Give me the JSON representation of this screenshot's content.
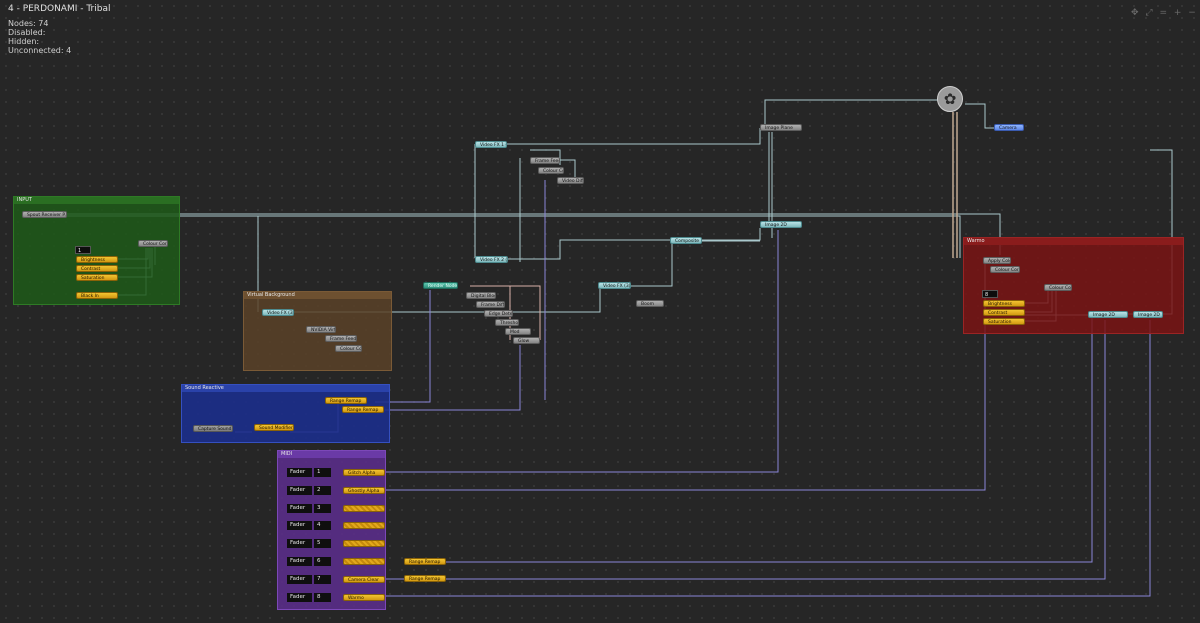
{
  "header": {
    "title": "4  -  PERDONAMI  -  Tribal",
    "stats": [
      {
        "label": "Nodes:",
        "value": "74"
      },
      {
        "label": "Disabled:",
        "value": ""
      },
      {
        "label": "Hidden:",
        "value": ""
      },
      {
        "label": "Unconnected:",
        "value": "4"
      }
    ]
  },
  "toolbar": {
    "icons": [
      "move-icon",
      "fit-icon",
      "equals-icon",
      "plus-icon",
      "minus-icon"
    ],
    "glyphs": "✥ ⤢ = + −"
  },
  "groups": {
    "input": {
      "title": "INPUT"
    },
    "virtual_background": {
      "title": "Virtual Background"
    },
    "sound_reactive": {
      "title": "Sound Reactive"
    },
    "midi": {
      "title": "MIDI"
    },
    "warmo": {
      "title": "Warmo"
    }
  },
  "input_group": {
    "value_box": "1",
    "source": "Spout Receiver P...",
    "colour_correct": "Colour Corr...",
    "params": [
      "Brightness",
      "Contrast",
      "Saturation",
      "Black In"
    ]
  },
  "top_chain": {
    "video_fx_1": "Video FX 1 (3)",
    "frame_feedback": "Frame Feedb...",
    "colour_corr": "Colour Corr...",
    "video_diff": "Video Diff...",
    "image_plane": "Image Plane",
    "camera": "Camera",
    "composite": "Composite 1...",
    "image_2d": "Image 2D"
  },
  "mid_chain": {
    "video_fx_2": "Video FX 2 (3)",
    "video_fx_3": "Video FX (3)",
    "render_node": "Render Node",
    "items": [
      "Digital Bloo...",
      "Frame Diff...",
      "Edge Detect",
      "Threshold",
      "Mod",
      "Glow"
    ],
    "boom": "Boom"
  },
  "vb_chain": {
    "video_fx": "Video FX (3)",
    "nvidia": "NVIDIA Virt...",
    "frame_feedb": "Frame Feedb...",
    "colour_corr": "Colour Corr..."
  },
  "sound_group": {
    "capture": "Capture Sound",
    "modifier": "Sound Modifier",
    "remap1": "Range Remap",
    "remap2": "Range Remap"
  },
  "midi_group": {
    "rows": [
      {
        "label": "Fader",
        "num": "1",
        "node": "Glitch Alpha"
      },
      {
        "label": "Fader",
        "num": "2",
        "node": "Ghostly Alpha"
      },
      {
        "label": "Fader",
        "num": "3",
        "node": ""
      },
      {
        "label": "Fader",
        "num": "4",
        "node": ""
      },
      {
        "label": "Fader",
        "num": "5",
        "node": ""
      },
      {
        "label": "Fader",
        "num": "6",
        "node": ""
      },
      {
        "label": "Fader",
        "num": "7",
        "node": "Camera Clear"
      },
      {
        "label": "Fader",
        "num": "8",
        "node": "Warmo"
      }
    ],
    "remap1": "Range Remap",
    "remap2": "Range Remap"
  },
  "warmo_group": {
    "value_box": "8",
    "apply_col": "Apply Colo...",
    "colour_corr": "Colour Corr...",
    "colour_corr2": "Colour Corr...",
    "params": [
      "Brightness",
      "Contrast",
      "Saturation"
    ],
    "image_2d_1": "Image 2D",
    "image_2d_2": "Image 2D"
  },
  "colors": {
    "input": "#1f5a19",
    "virtual_background": "#5a4228",
    "sound_reactive": "#1c2f8c",
    "midi": "#5a2d8a",
    "warmo": "#7a1414",
    "wire_light": "#a9c8cc",
    "wire_purple": "#8a86d8"
  }
}
